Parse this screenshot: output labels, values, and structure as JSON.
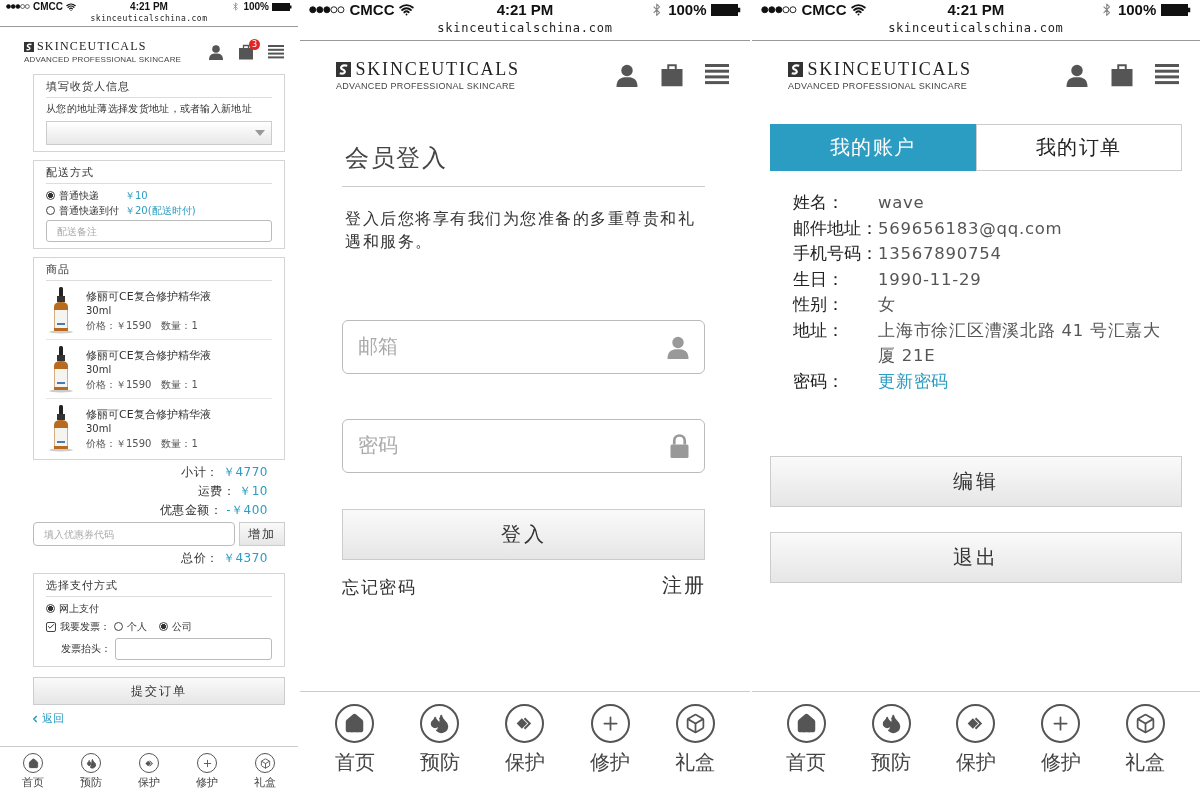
{
  "screens": [
    {
      "kind": "checkout",
      "status_bar": {
        "carrier": "CMCC",
        "time": "4:21 PM",
        "battery": "100%"
      },
      "url": "skinceuticalschina.com",
      "brand": {
        "name": "SKINCEUTICALS",
        "tagline": "ADVANCED PROFESSIONAL SKINCARE"
      },
      "cart_count": "3",
      "address": {
        "title": "填写收货人信息",
        "hint": "从您的地址薄选择发货地址，或者输入新地址"
      },
      "shipping": {
        "title": "配送方式",
        "options": [
          {
            "label": "普通快递",
            "price": "￥10",
            "selected": true
          },
          {
            "label": "普通快递到付",
            "price": "￥20(配送时付)",
            "selected": false
          }
        ],
        "note": {
          "placeholder": "配送备注"
        }
      },
      "products": {
        "title": "商品",
        "items": [
          {
            "name": "修丽可CE复合修护精华液",
            "size": "30ml",
            "price": "价格：￥1590",
            "qty": "数量：1"
          },
          {
            "name": "修丽可CE复合修护精华液",
            "size": "30ml",
            "price": "价格：￥1590",
            "qty": "数量：1"
          },
          {
            "name": "修丽可CE复合修护精华液",
            "size": "30ml",
            "price": "价格：￥1590",
            "qty": "数量：1"
          }
        ]
      },
      "totals": [
        {
          "label": "小计：",
          "value": "￥4770"
        },
        {
          "label": "运费：",
          "value": "￥10"
        },
        {
          "label": "优惠金额：",
          "value": "-￥400"
        }
      ],
      "coupon": {
        "placeholder": "填入优惠券代码",
        "button": "增加"
      },
      "grand_total": {
        "label": "总价：",
        "value": "￥4370"
      },
      "payment": {
        "title": "选择支付方式",
        "online": {
          "label": "网上支付",
          "selected": true
        },
        "invoice": {
          "label": "我要发票：",
          "checked": true,
          "types": [
            {
              "label": "个人",
              "selected": false
            },
            {
              "label": "公司",
              "selected": true
            }
          ]
        },
        "invoice_title": {
          "label": "发票抬头："
        }
      },
      "submit": "提交订单",
      "back": "返回",
      "tabbar": [
        "首页",
        "预防",
        "保护",
        "修护",
        "礼盒"
      ]
    },
    {
      "kind": "login",
      "status_bar": {
        "carrier": "CMCC",
        "time": "4:21 PM",
        "battery": "100%"
      },
      "url": "skinceuticalschina.com",
      "brand": {
        "name": "SKINCEUTICALS",
        "tagline": "ADVANCED PROFESSIONAL SKINCARE"
      },
      "title": "会员登入",
      "description": "登入后您将享有我们为您准备的多重尊贵和礼遇和服务。",
      "email": {
        "placeholder": "邮箱"
      },
      "password": {
        "placeholder": "密码"
      },
      "login_button": "登入",
      "forgot": "忘记密码",
      "register": "注册",
      "tabbar": [
        "首页",
        "预防",
        "保护",
        "修护",
        "礼盒"
      ]
    },
    {
      "kind": "account",
      "status_bar": {
        "carrier": "CMCC",
        "time": "4:21 PM",
        "battery": "100%"
      },
      "url": "skinceuticalschina.com",
      "brand": {
        "name": "SKINCEUTICALS",
        "tagline": "ADVANCED PROFESSIONAL SKINCARE"
      },
      "tabs": [
        {
          "label": "我的账户",
          "selected": true
        },
        {
          "label": "我的订单",
          "selected": false
        }
      ],
      "fields": [
        {
          "label": "姓名：",
          "value": "wave",
          "kind": "text"
        },
        {
          "label": "邮件地址：",
          "value": "569656183@qq.com",
          "kind": "text"
        },
        {
          "label": "手机号码：",
          "value": "13567890754",
          "kind": "text"
        },
        {
          "label": "生日：",
          "value": "1990-11-29",
          "kind": "text"
        },
        {
          "label": "性别：",
          "value": "女",
          "kind": "text"
        },
        {
          "label": "地址：",
          "value": "上海市徐汇区漕溪北路 41 号汇嘉大厦 21E",
          "kind": "text"
        },
        {
          "label": "密码：",
          "value": "更新密码",
          "kind": "link"
        }
      ],
      "buttons": [
        "编辑",
        "退出"
      ],
      "tabbar": [
        "首页",
        "预防",
        "保护",
        "修护",
        "礼盒"
      ]
    }
  ]
}
